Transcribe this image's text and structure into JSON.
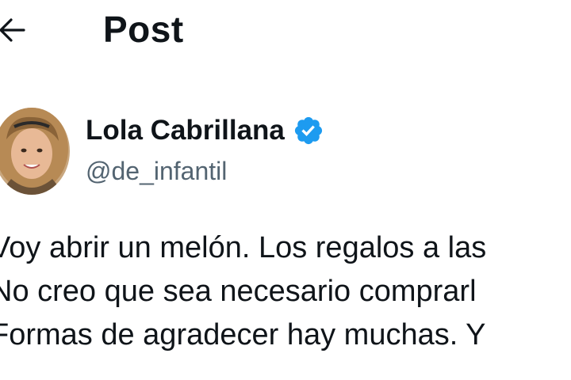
{
  "header": {
    "back_icon": "arrow-left-icon",
    "title": "Post"
  },
  "author": {
    "display_name": "Lola Cabrillana",
    "handle": "@de_infantil",
    "verified": true,
    "verified_icon": "verified-badge-icon",
    "verified_color": "#1d9bf0"
  },
  "post": {
    "lines": [
      "Voy abrir un melón. Los regalos a las",
      "No creo que sea necesario comprarl",
      "Formas de agradecer hay muchas. Y"
    ]
  },
  "colors": {
    "text": "#0f1419",
    "secondary_text": "#536471",
    "background": "#ffffff"
  }
}
